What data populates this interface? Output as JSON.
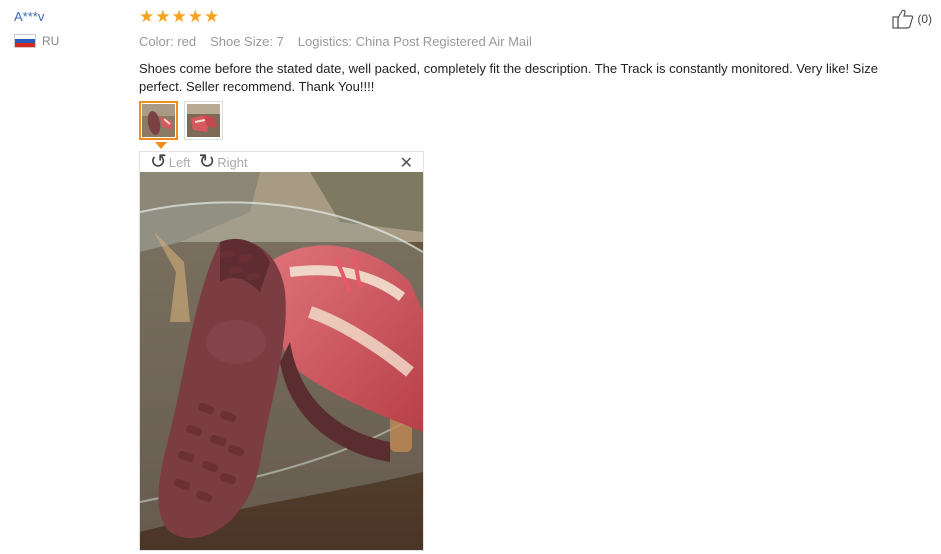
{
  "reviewer": {
    "name": "A***v",
    "country": "RU"
  },
  "rating": {
    "stars": 5,
    "max": 5
  },
  "meta": {
    "color": "Color: red",
    "shoe_size": "Shoe Size: 7",
    "logistics": "Logistics: China Post Registered Air Mail"
  },
  "review": {
    "text": "Shoes come before the stated date, well packed, completely fit the description. The Track is constantly monitored. Very like! Size perfect. Seller recommend. Thank You!!!!"
  },
  "viewer": {
    "rotate_left": "Left",
    "rotate_right": "Right",
    "close_icon": "close-icon"
  },
  "helpful": {
    "count": "(0)",
    "icon": "thumbs-up-icon"
  },
  "colors": {
    "accent": "#f08d1a",
    "star": "#f6a21b",
    "link": "#3a6ab4"
  }
}
